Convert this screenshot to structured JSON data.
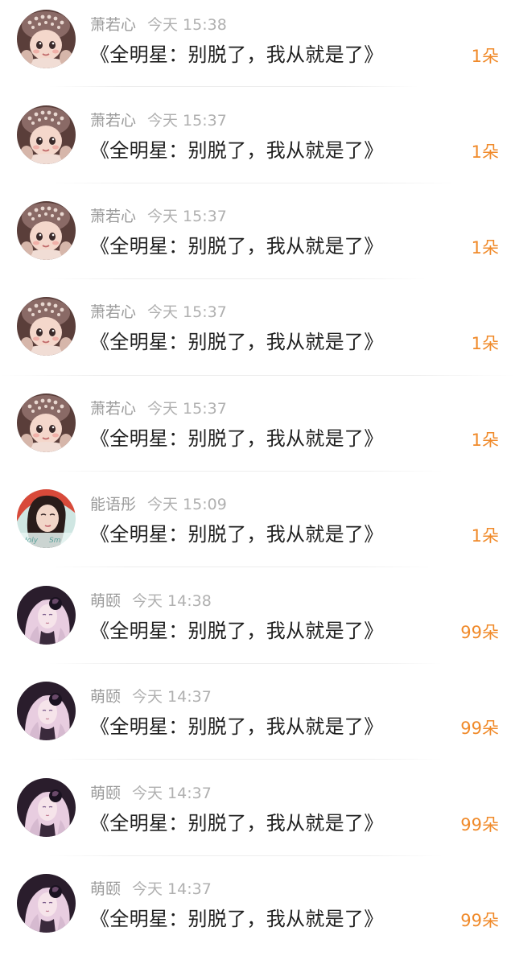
{
  "messages": [
    {
      "user": "萧若心",
      "time": "今天 15:38",
      "text": "《全明星：别脱了，我从就是了》",
      "gift": "1朵",
      "avatar": "doll-girl-pearl-headdress"
    },
    {
      "user": "萧若心",
      "time": "今天 15:37",
      "text": "《全明星：别脱了，我从就是了》",
      "gift": "1朵",
      "avatar": "doll-girl-pearl-headdress"
    },
    {
      "user": "萧若心",
      "time": "今天 15:37",
      "text": "《全明星：别脱了，我从就是了》",
      "gift": "1朵",
      "avatar": "doll-girl-pearl-headdress"
    },
    {
      "user": "萧若心",
      "time": "今天 15:37",
      "text": "《全明星：别脱了，我从就是了》",
      "gift": "1朵",
      "avatar": "doll-girl-pearl-headdress"
    },
    {
      "user": "萧若心",
      "time": "今天 15:37",
      "text": "《全明星：别脱了，我从就是了》",
      "gift": "1朵",
      "avatar": "doll-girl-pearl-headdress"
    },
    {
      "user": "能语彤",
      "time": "今天 15:09",
      "text": "《全明星：别脱了，我从就是了》",
      "gift": "1朵",
      "avatar": "woman-portrait-photo"
    },
    {
      "user": "萌颐",
      "time": "今天 14:38",
      "text": "《全明星：别脱了，我从就是了》",
      "gift": "99朵",
      "avatar": "anime-girl-dark-rose"
    },
    {
      "user": "萌颐",
      "time": "今天 14:37",
      "text": "《全明星：别脱了，我从就是了》",
      "gift": "99朵",
      "avatar": "anime-girl-dark-rose"
    },
    {
      "user": "萌颐",
      "time": "今天 14:37",
      "text": "《全明星：别脱了，我从就是了》",
      "gift": "99朵",
      "avatar": "anime-girl-dark-rose"
    },
    {
      "user": "萌颐",
      "time": "今天 14:37",
      "text": "《全明星：别脱了，我从就是了》",
      "gift": "99朵",
      "avatar": "anime-girl-dark-rose"
    }
  ],
  "colors": {
    "gift": "#f08a2a",
    "meta": "#9a9a9a",
    "text": "#1f1f1f",
    "divider": "#ededed"
  }
}
